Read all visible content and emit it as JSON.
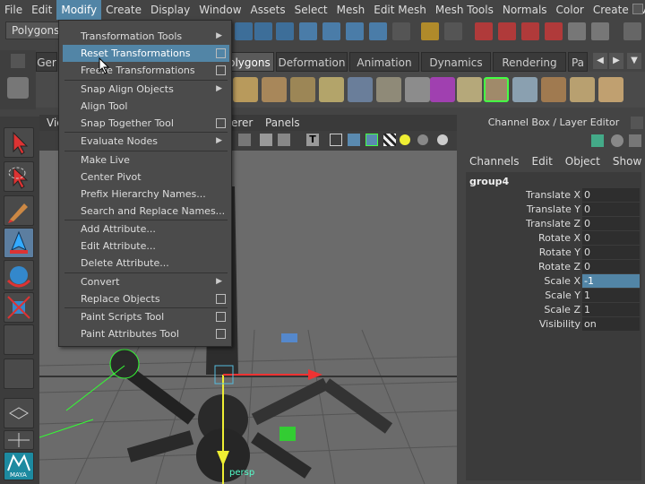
{
  "menubar": {
    "items": [
      "File",
      "Edit",
      "Modify",
      "Create",
      "Display",
      "Window",
      "Assets",
      "Select",
      "Mesh",
      "Edit Mesh",
      "Mesh Tools",
      "Normals",
      "Color",
      "Create UVs"
    ],
    "active_index": 2
  },
  "statusline": {
    "mode": "Polygons"
  },
  "shelf": {
    "tabs": [
      "Ger",
      "Polygons",
      "Deformation",
      "Animation",
      "Dynamics",
      "Rendering",
      "Pa"
    ],
    "active_tab": "Polygons"
  },
  "modify_menu": {
    "items": [
      {
        "label": "Transformation Tools",
        "kind": "submenu"
      },
      {
        "label": "Reset Transformations",
        "kind": "option",
        "highlighted": true
      },
      {
        "label": "Freeze Transformations",
        "kind": "option"
      },
      {
        "label": "Snap Align Objects",
        "kind": "submenu"
      },
      {
        "label": "Align Tool",
        "kind": "plain"
      },
      {
        "label": "Snap Together Tool",
        "kind": "option"
      },
      {
        "label": "Evaluate Nodes",
        "kind": "submenu"
      },
      {
        "label": "Make Live",
        "kind": "plain"
      },
      {
        "label": "Center Pivot",
        "kind": "plain"
      },
      {
        "label": "Prefix Hierarchy Names...",
        "kind": "plain"
      },
      {
        "label": "Search and Replace Names...",
        "kind": "plain"
      },
      {
        "label": "Add Attribute...",
        "kind": "plain"
      },
      {
        "label": "Edit Attribute...",
        "kind": "plain"
      },
      {
        "label": "Delete Attribute...",
        "kind": "plain"
      },
      {
        "label": "Convert",
        "kind": "submenu"
      },
      {
        "label": "Replace Objects",
        "kind": "option"
      },
      {
        "label": "Paint Scripts Tool",
        "kind": "option"
      },
      {
        "label": "Paint Attributes Tool",
        "kind": "option"
      }
    ]
  },
  "viewport": {
    "menu": [
      "Vie",
      "erer",
      "Panels"
    ],
    "camera_label": "persp"
  },
  "channel_box": {
    "title": "Channel Box / Layer Editor",
    "menu": [
      "Channels",
      "Edit",
      "Object",
      "Show"
    ],
    "node": "group4",
    "attributes": [
      {
        "label": "Translate X",
        "value": "0"
      },
      {
        "label": "Translate Y",
        "value": "0"
      },
      {
        "label": "Translate Z",
        "value": "0"
      },
      {
        "label": "Rotate X",
        "value": "0"
      },
      {
        "label": "Rotate Y",
        "value": "0"
      },
      {
        "label": "Rotate Z",
        "value": "0"
      },
      {
        "label": "Scale X",
        "value": "-1",
        "selected": true
      },
      {
        "label": "Scale Y",
        "value": "1"
      },
      {
        "label": "Scale Z",
        "value": "1"
      },
      {
        "label": "Visibility",
        "value": "on"
      }
    ]
  },
  "toolbox": {
    "bottom_label": "MAYA"
  },
  "colors": {
    "accent": "#5285a6",
    "panel": "#444444",
    "viewport": "#6b6b6b"
  }
}
